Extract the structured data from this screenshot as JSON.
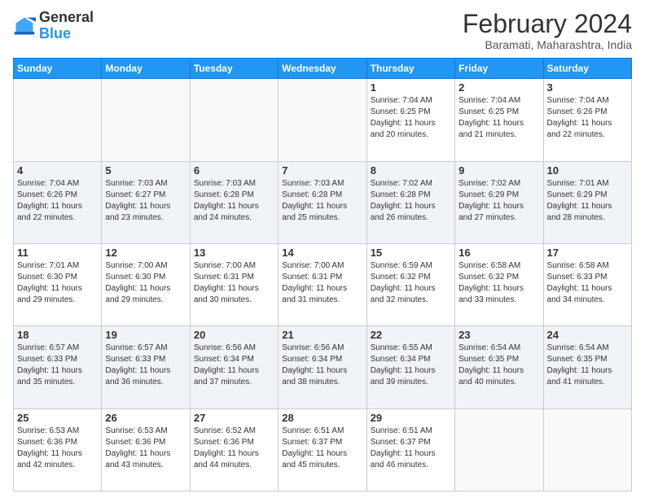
{
  "header": {
    "logo_general": "General",
    "logo_blue": "Blue",
    "month_title": "February 2024",
    "location": "Baramati, Maharashtra, India"
  },
  "days_of_week": [
    "Sunday",
    "Monday",
    "Tuesday",
    "Wednesday",
    "Thursday",
    "Friday",
    "Saturday"
  ],
  "weeks": [
    [
      {
        "day": "",
        "detail": ""
      },
      {
        "day": "",
        "detail": ""
      },
      {
        "day": "",
        "detail": ""
      },
      {
        "day": "",
        "detail": ""
      },
      {
        "day": "1",
        "detail": "Sunrise: 7:04 AM\nSunset: 6:25 PM\nDaylight: 11 hours\nand 20 minutes."
      },
      {
        "day": "2",
        "detail": "Sunrise: 7:04 AM\nSunset: 6:25 PM\nDaylight: 11 hours\nand 21 minutes."
      },
      {
        "day": "3",
        "detail": "Sunrise: 7:04 AM\nSunset: 6:26 PM\nDaylight: 11 hours\nand 22 minutes."
      }
    ],
    [
      {
        "day": "4",
        "detail": "Sunrise: 7:04 AM\nSunset: 6:26 PM\nDaylight: 11 hours\nand 22 minutes."
      },
      {
        "day": "5",
        "detail": "Sunrise: 7:03 AM\nSunset: 6:27 PM\nDaylight: 11 hours\nand 23 minutes."
      },
      {
        "day": "6",
        "detail": "Sunrise: 7:03 AM\nSunset: 6:28 PM\nDaylight: 11 hours\nand 24 minutes."
      },
      {
        "day": "7",
        "detail": "Sunrise: 7:03 AM\nSunset: 6:28 PM\nDaylight: 11 hours\nand 25 minutes."
      },
      {
        "day": "8",
        "detail": "Sunrise: 7:02 AM\nSunset: 6:28 PM\nDaylight: 11 hours\nand 26 minutes."
      },
      {
        "day": "9",
        "detail": "Sunrise: 7:02 AM\nSunset: 6:29 PM\nDaylight: 11 hours\nand 27 minutes."
      },
      {
        "day": "10",
        "detail": "Sunrise: 7:01 AM\nSunset: 6:29 PM\nDaylight: 11 hours\nand 28 minutes."
      }
    ],
    [
      {
        "day": "11",
        "detail": "Sunrise: 7:01 AM\nSunset: 6:30 PM\nDaylight: 11 hours\nand 29 minutes."
      },
      {
        "day": "12",
        "detail": "Sunrise: 7:00 AM\nSunset: 6:30 PM\nDaylight: 11 hours\nand 29 minutes."
      },
      {
        "day": "13",
        "detail": "Sunrise: 7:00 AM\nSunset: 6:31 PM\nDaylight: 11 hours\nand 30 minutes."
      },
      {
        "day": "14",
        "detail": "Sunrise: 7:00 AM\nSunset: 6:31 PM\nDaylight: 11 hours\nand 31 minutes."
      },
      {
        "day": "15",
        "detail": "Sunrise: 6:59 AM\nSunset: 6:32 PM\nDaylight: 11 hours\nand 32 minutes."
      },
      {
        "day": "16",
        "detail": "Sunrise: 6:58 AM\nSunset: 6:32 PM\nDaylight: 11 hours\nand 33 minutes."
      },
      {
        "day": "17",
        "detail": "Sunrise: 6:58 AM\nSunset: 6:33 PM\nDaylight: 11 hours\nand 34 minutes."
      }
    ],
    [
      {
        "day": "18",
        "detail": "Sunrise: 6:57 AM\nSunset: 6:33 PM\nDaylight: 11 hours\nand 35 minutes."
      },
      {
        "day": "19",
        "detail": "Sunrise: 6:57 AM\nSunset: 6:33 PM\nDaylight: 11 hours\nand 36 minutes."
      },
      {
        "day": "20",
        "detail": "Sunrise: 6:56 AM\nSunset: 6:34 PM\nDaylight: 11 hours\nand 37 minutes."
      },
      {
        "day": "21",
        "detail": "Sunrise: 6:56 AM\nSunset: 6:34 PM\nDaylight: 11 hours\nand 38 minutes."
      },
      {
        "day": "22",
        "detail": "Sunrise: 6:55 AM\nSunset: 6:34 PM\nDaylight: 11 hours\nand 39 minutes."
      },
      {
        "day": "23",
        "detail": "Sunrise: 6:54 AM\nSunset: 6:35 PM\nDaylight: 11 hours\nand 40 minutes."
      },
      {
        "day": "24",
        "detail": "Sunrise: 6:54 AM\nSunset: 6:35 PM\nDaylight: 11 hours\nand 41 minutes."
      }
    ],
    [
      {
        "day": "25",
        "detail": "Sunrise: 6:53 AM\nSunset: 6:36 PM\nDaylight: 11 hours\nand 42 minutes."
      },
      {
        "day": "26",
        "detail": "Sunrise: 6:53 AM\nSunset: 6:36 PM\nDaylight: 11 hours\nand 43 minutes."
      },
      {
        "day": "27",
        "detail": "Sunrise: 6:52 AM\nSunset: 6:36 PM\nDaylight: 11 hours\nand 44 minutes."
      },
      {
        "day": "28",
        "detail": "Sunrise: 6:51 AM\nSunset: 6:37 PM\nDaylight: 11 hours\nand 45 minutes."
      },
      {
        "day": "29",
        "detail": "Sunrise: 6:51 AM\nSunset: 6:37 PM\nDaylight: 11 hours\nand 46 minutes."
      },
      {
        "day": "",
        "detail": ""
      },
      {
        "day": "",
        "detail": ""
      }
    ]
  ],
  "shaded_rows": [
    1,
    3
  ]
}
